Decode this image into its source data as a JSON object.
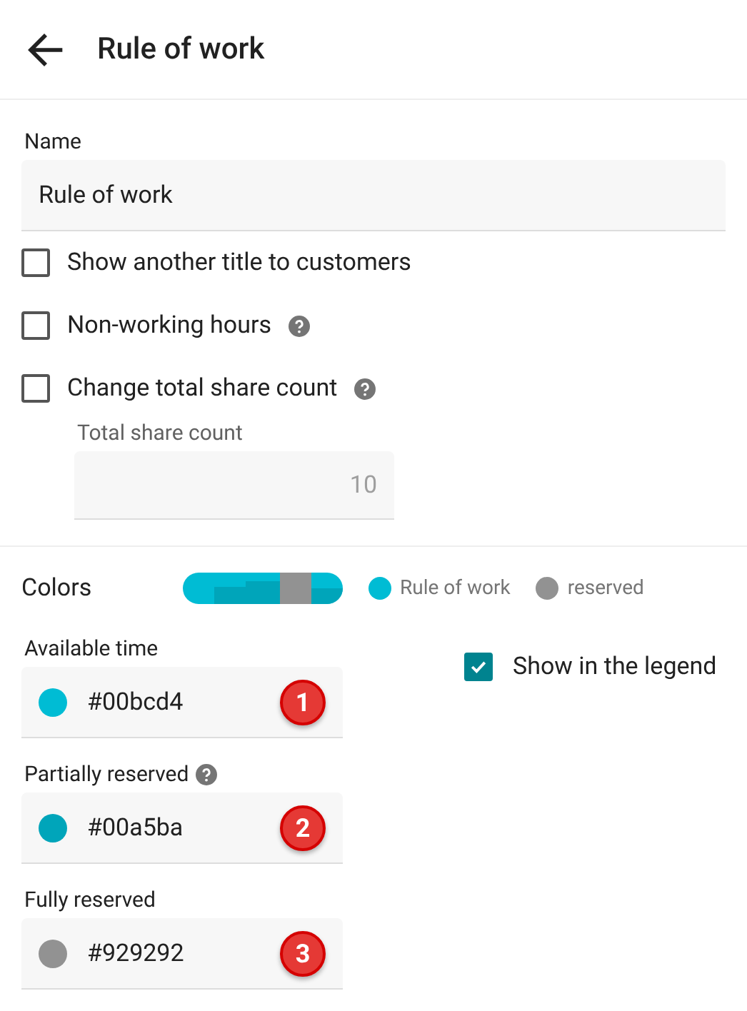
{
  "header": {
    "title": "Rule of work"
  },
  "name_field": {
    "label": "Name",
    "value": "Rule of work"
  },
  "options": [
    {
      "label": "Show another title to customers",
      "checked": false,
      "help": false
    },
    {
      "label": "Non-working hours",
      "checked": false,
      "help": true
    },
    {
      "label": "Change total share count",
      "checked": false,
      "help": true
    }
  ],
  "share_field": {
    "label": "Total share count",
    "value": "10",
    "disabled": true
  },
  "colors": {
    "label": "Colors",
    "legend": [
      {
        "label": "Rule of work",
        "color": "#00bcd4"
      },
      {
        "label": "reserved",
        "color": "#929292"
      }
    ],
    "show_in_legend": {
      "label": "Show in the legend",
      "checked": true
    },
    "items": [
      {
        "label": "Available time",
        "value": "#00bcd4",
        "color": "#00bcd4",
        "help": false,
        "marker": "1"
      },
      {
        "label": "Partially reserved",
        "value": "#00a5ba",
        "color": "#00a5ba",
        "help": true,
        "marker": "2"
      },
      {
        "label": "Fully reserved",
        "value": "#929292",
        "color": "#929292",
        "help": false,
        "marker": "3"
      }
    ]
  }
}
